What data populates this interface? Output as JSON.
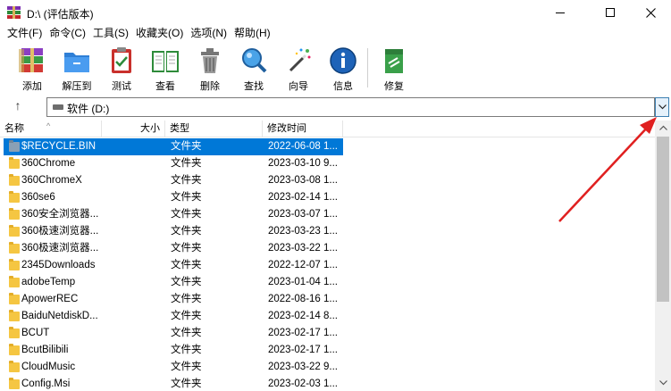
{
  "window": {
    "title": "D:\\ (评估版本)",
    "controls": {
      "minimize": "—",
      "maximize": "☐",
      "close": "✕"
    }
  },
  "menu": [
    "文件(F)",
    "命令(C)",
    "工具(S)",
    "收藏夹(O)",
    "选项(N)",
    "帮助(H)"
  ],
  "toolbar": [
    {
      "label": "添加",
      "icon": "archive-add-icon"
    },
    {
      "label": "解压到",
      "icon": "extract-folder-icon"
    },
    {
      "label": "测试",
      "icon": "test-clipboard-icon"
    },
    {
      "label": "查看",
      "icon": "view-book-icon"
    },
    {
      "label": "删除",
      "icon": "trash-icon"
    },
    {
      "label": "查找",
      "icon": "search-magnifier-icon"
    },
    {
      "label": "向导",
      "icon": "wizard-wand-icon"
    },
    {
      "label": "信息",
      "icon": "info-icon"
    },
    {
      "label": "修复",
      "icon": "repair-icon"
    }
  ],
  "address": {
    "up": "↑",
    "path": "软件 (D:)",
    "dropdown": "⌄"
  },
  "columns": {
    "name": "名称",
    "size": "大小",
    "type": "类型",
    "modified": "修改时间"
  },
  "files": [
    {
      "name": "$RECYCLE.BIN",
      "type": "文件夹",
      "modified": "2022-06-08 1...",
      "selected": true
    },
    {
      "name": "360Chrome",
      "type": "文件夹",
      "modified": "2023-03-10 9..."
    },
    {
      "name": "360ChromeX",
      "type": "文件夹",
      "modified": "2023-03-08 1..."
    },
    {
      "name": "360se6",
      "type": "文件夹",
      "modified": "2023-02-14 1..."
    },
    {
      "name": "360安全浏览器...",
      "type": "文件夹",
      "modified": "2023-03-07 1..."
    },
    {
      "name": "360极速浏览器...",
      "type": "文件夹",
      "modified": "2023-03-23 1..."
    },
    {
      "name": "360极速浏览器...",
      "type": "文件夹",
      "modified": "2023-03-22 1..."
    },
    {
      "name": "2345Downloads",
      "type": "文件夹",
      "modified": "2022-12-07 1..."
    },
    {
      "name": "adobeTemp",
      "type": "文件夹",
      "modified": "2023-01-04 1..."
    },
    {
      "name": "ApowerREC",
      "type": "文件夹",
      "modified": "2022-08-16 1..."
    },
    {
      "name": "BaiduNetdiskD...",
      "type": "文件夹",
      "modified": "2023-02-14 8..."
    },
    {
      "name": "BCUT",
      "type": "文件夹",
      "modified": "2023-02-17 1..."
    },
    {
      "name": "BcutBilibili",
      "type": "文件夹",
      "modified": "2023-02-17 1..."
    },
    {
      "name": "CloudMusic",
      "type": "文件夹",
      "modified": "2023-03-22 9..."
    },
    {
      "name": "Config.Msi",
      "type": "文件夹",
      "modified": "2023-02-03 1..."
    }
  ],
  "colors": {
    "selection": "#0078d7",
    "folder": "#f5c642",
    "annotation": "#e02020"
  }
}
